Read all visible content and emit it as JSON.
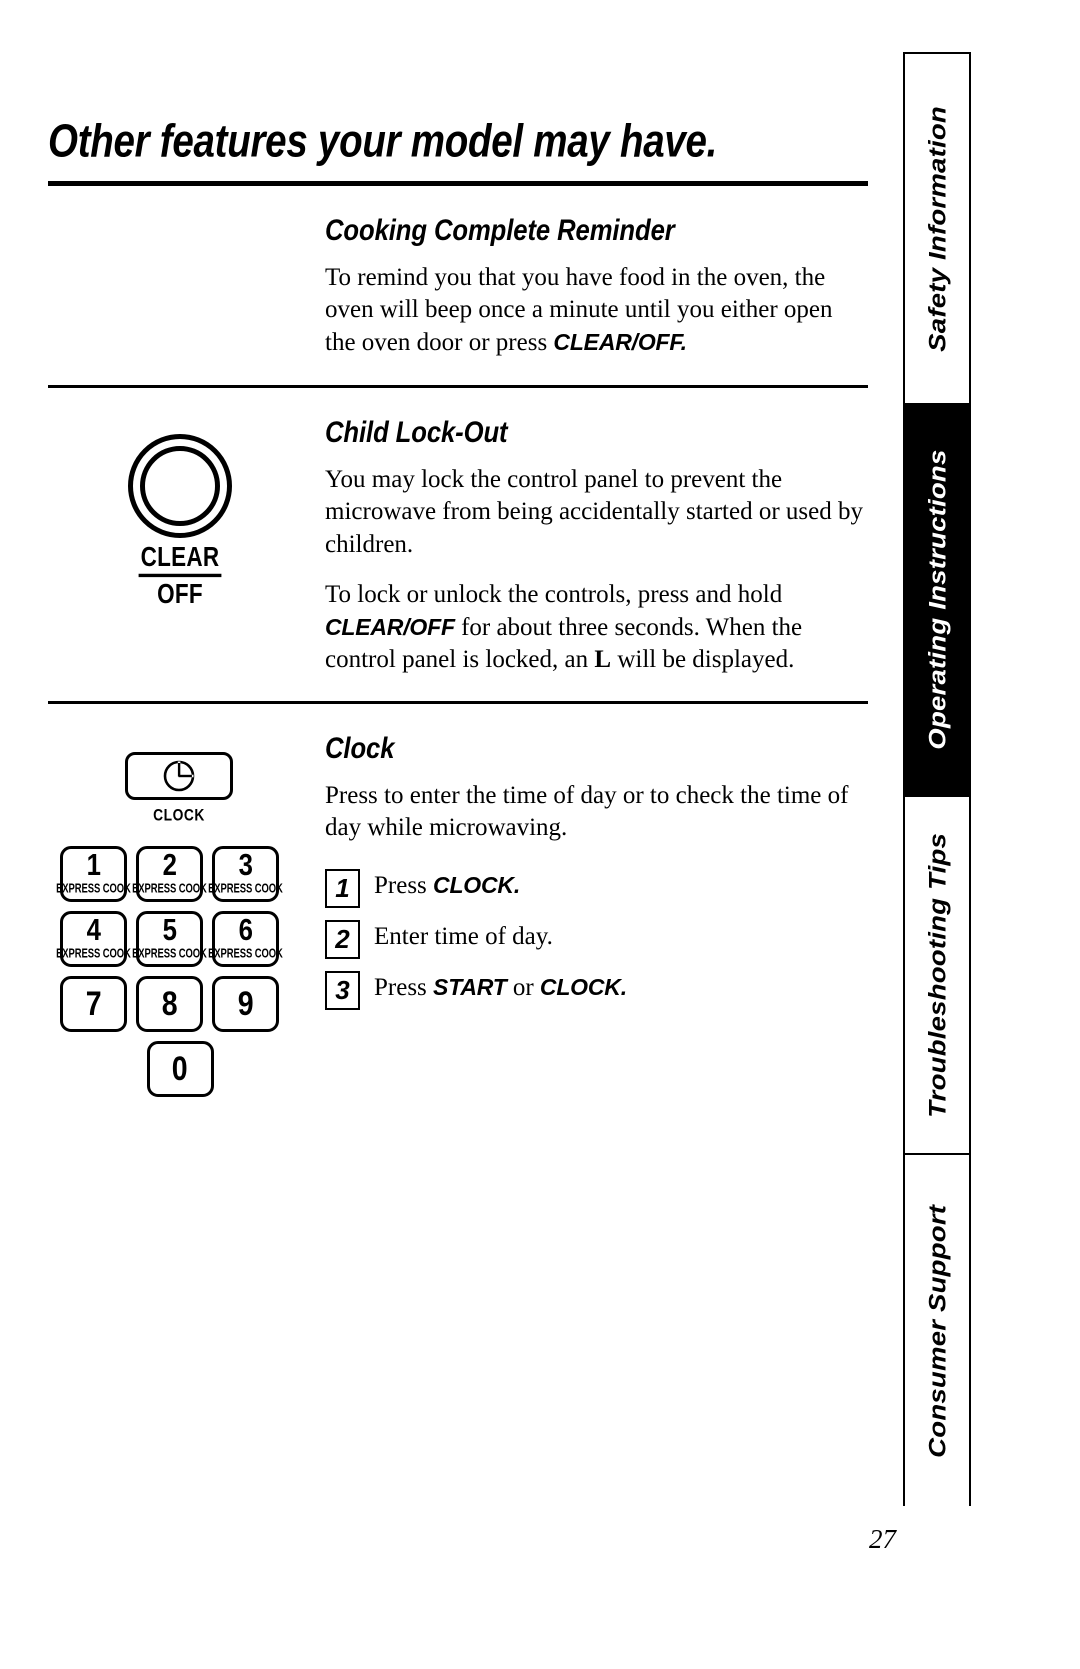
{
  "page": {
    "title": "Other features your model may have.",
    "page_number": "27"
  },
  "side_tabs": [
    {
      "label": "Safety Information",
      "active": false
    },
    {
      "label": "Operating Instructions",
      "active": true
    },
    {
      "label": "Troubleshooting Tips",
      "active": false
    },
    {
      "label": "Consumer Support",
      "active": false
    }
  ],
  "sections": [
    {
      "heading": "Cooking Complete Reminder",
      "paragraphs": [
        {
          "parts": [
            {
              "text": "To remind you that you have food in the oven, the oven will beep once a minute until you either open the oven door or press ",
              "style": "normal"
            },
            {
              "text": "CLEAR/OFF.",
              "style": "bold-italic"
            }
          ]
        }
      ]
    },
    {
      "heading": "Child Lock-Out",
      "art": {
        "type": "clear-off-button",
        "label_top": "CLEAR",
        "label_bottom": "OFF"
      },
      "paragraphs": [
        {
          "parts": [
            {
              "text": "You may lock the control panel to prevent the microwave from being accidentally started or used by children.",
              "style": "normal"
            }
          ]
        },
        {
          "parts": [
            {
              "text": "To lock or unlock the controls, press and hold ",
              "style": "normal"
            },
            {
              "text": "CLEAR/OFF",
              "style": "bold-italic"
            },
            {
              "text": " for about three seconds. When the control panel is locked, an ",
              "style": "normal"
            },
            {
              "text": "L",
              "style": "bold-serif"
            },
            {
              "text": " will be displayed.",
              "style": "normal"
            }
          ]
        }
      ]
    },
    {
      "heading": "Clock",
      "art": {
        "type": "clock-keypad",
        "clock_caption": "CLOCK",
        "clock_icon": "clock-icon",
        "keypad": [
          [
            {
              "digit": "1",
              "sub": "EXPRESS COOK"
            },
            {
              "digit": "2",
              "sub": "EXPRESS COOK"
            },
            {
              "digit": "3",
              "sub": "EXPRESS COOK"
            }
          ],
          [
            {
              "digit": "4",
              "sub": "EXPRESS COOK"
            },
            {
              "digit": "5",
              "sub": "EXPRESS COOK"
            },
            {
              "digit": "6",
              "sub": "EXPRESS COOK"
            }
          ],
          [
            {
              "digit": "7",
              "sub": ""
            },
            {
              "digit": "8",
              "sub": ""
            },
            {
              "digit": "9",
              "sub": ""
            }
          ],
          [
            {
              "digit": "0",
              "sub": ""
            }
          ]
        ]
      },
      "paragraphs": [
        {
          "parts": [
            {
              "text": "Press to enter the time of day or to check the time of day while microwaving.",
              "style": "normal"
            }
          ]
        }
      ],
      "steps": [
        {
          "number": "1",
          "parts": [
            {
              "text": "Press ",
              "style": "normal"
            },
            {
              "text": "CLOCK.",
              "style": "bold-italic"
            }
          ]
        },
        {
          "number": "2",
          "parts": [
            {
              "text": "Enter time of day.",
              "style": "normal"
            }
          ]
        },
        {
          "number": "3",
          "parts": [
            {
              "text": "Press ",
              "style": "normal"
            },
            {
              "text": "START",
              "style": "bold-italic"
            },
            {
              "text": " or ",
              "style": "normal"
            },
            {
              "text": "CLOCK.",
              "style": "bold-italic"
            }
          ]
        }
      ]
    }
  ]
}
